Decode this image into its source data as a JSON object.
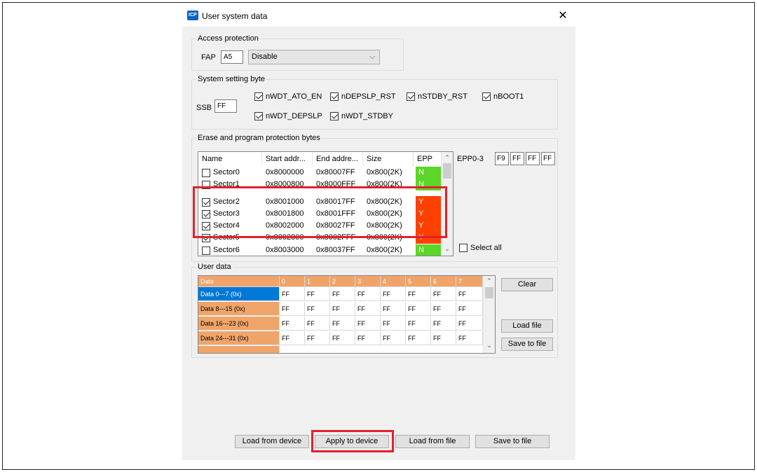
{
  "window": {
    "title": "User system data",
    "app_icon_text": "ICP"
  },
  "access_protection": {
    "legend": "Access protection",
    "fap_label": "FAP",
    "fap_value": "A5",
    "mode_value": "Disable"
  },
  "system_setting": {
    "legend": "System setting byte",
    "ssb_label": "SSB",
    "ssb_value": "FF",
    "options": [
      {
        "label": "nWDT_ATO_EN",
        "checked": true
      },
      {
        "label": "nDEPSLP_RST",
        "checked": true
      },
      {
        "label": "nSTDBY_RST",
        "checked": true
      },
      {
        "label": "nBOOT1",
        "checked": true
      },
      {
        "label": "nWDT_DEPSLP",
        "checked": true
      },
      {
        "label": "nWDT_STDBY",
        "checked": true
      }
    ]
  },
  "erase_protection": {
    "legend": "Erase and program protection bytes",
    "columns": [
      "Name",
      "Start addr...",
      "End addre...",
      "Size",
      "EPP"
    ],
    "sectors": [
      {
        "name": "Sector0",
        "start": "0x8000000",
        "end": "0x80007FF",
        "size": "0x800(2K)",
        "epp": "N",
        "checked": false
      },
      {
        "name": "Sector1",
        "start": "0x8000800",
        "end": "0x8000FFF",
        "size": "0x800(2K)",
        "epp": "N",
        "checked": false
      },
      {
        "name": "Sector2",
        "start": "0x8001000",
        "end": "0x80017FF",
        "size": "0x800(2K)",
        "epp": "Y",
        "checked": true
      },
      {
        "name": "Sector3",
        "start": "0x8001800",
        "end": "0x8001FFF",
        "size": "0x800(2K)",
        "epp": "Y",
        "checked": true
      },
      {
        "name": "Sector4",
        "start": "0x8002000",
        "end": "0x80027FF",
        "size": "0x800(2K)",
        "epp": "Y",
        "checked": true
      },
      {
        "name": "Sector5",
        "start": "0x8002800",
        "end": "0x8002FFF",
        "size": "0x800(2K)",
        "epp": "Y",
        "checked": true
      },
      {
        "name": "Sector6",
        "start": "0x8003000",
        "end": "0x80037FF",
        "size": "0x800(2K)",
        "epp": "N",
        "checked": false
      }
    ],
    "epp_label": "EPP0-3",
    "epp_values": [
      "F9",
      "FF",
      "FF",
      "FF"
    ],
    "select_all_label": "Select all",
    "colors": {
      "epp_y": "#ff4000",
      "epp_n": "#5cd627"
    }
  },
  "user_data": {
    "legend": "User data",
    "header": [
      "Date",
      "0",
      "1",
      "2",
      "3",
      "4",
      "5",
      "6",
      "7"
    ],
    "rows": [
      {
        "label": "Data 0---7 (0x)",
        "values": [
          "FF",
          "FF",
          "FF",
          "FF",
          "FF",
          "FF",
          "FF",
          "FF"
        ]
      },
      {
        "label": "Data 8---15 (0x)",
        "values": [
          "FF",
          "FF",
          "FF",
          "FF",
          "FF",
          "FF",
          "FF",
          "FF"
        ]
      },
      {
        "label": "Data 16---23 (0x)",
        "values": [
          "FF",
          "FF",
          "FF",
          "FF",
          "FF",
          "FF",
          "FF",
          "FF"
        ]
      },
      {
        "label": "Data 24---31 (0x)",
        "values": [
          "FF",
          "FF",
          "FF",
          "FF",
          "FF",
          "FF",
          "FF",
          "FF"
        ]
      }
    ],
    "clear_label": "Clear",
    "load_file_label": "Load file",
    "save_file_label": "Save to file"
  },
  "footer": {
    "load_device": "Load from device",
    "apply_device": "Apply to device",
    "load_file": "Load from file",
    "save_file": "Save to file"
  },
  "colors": {
    "highlight": "#e3202a",
    "header_orange": "#f0a46a",
    "selected_blue": "#0078d7"
  }
}
